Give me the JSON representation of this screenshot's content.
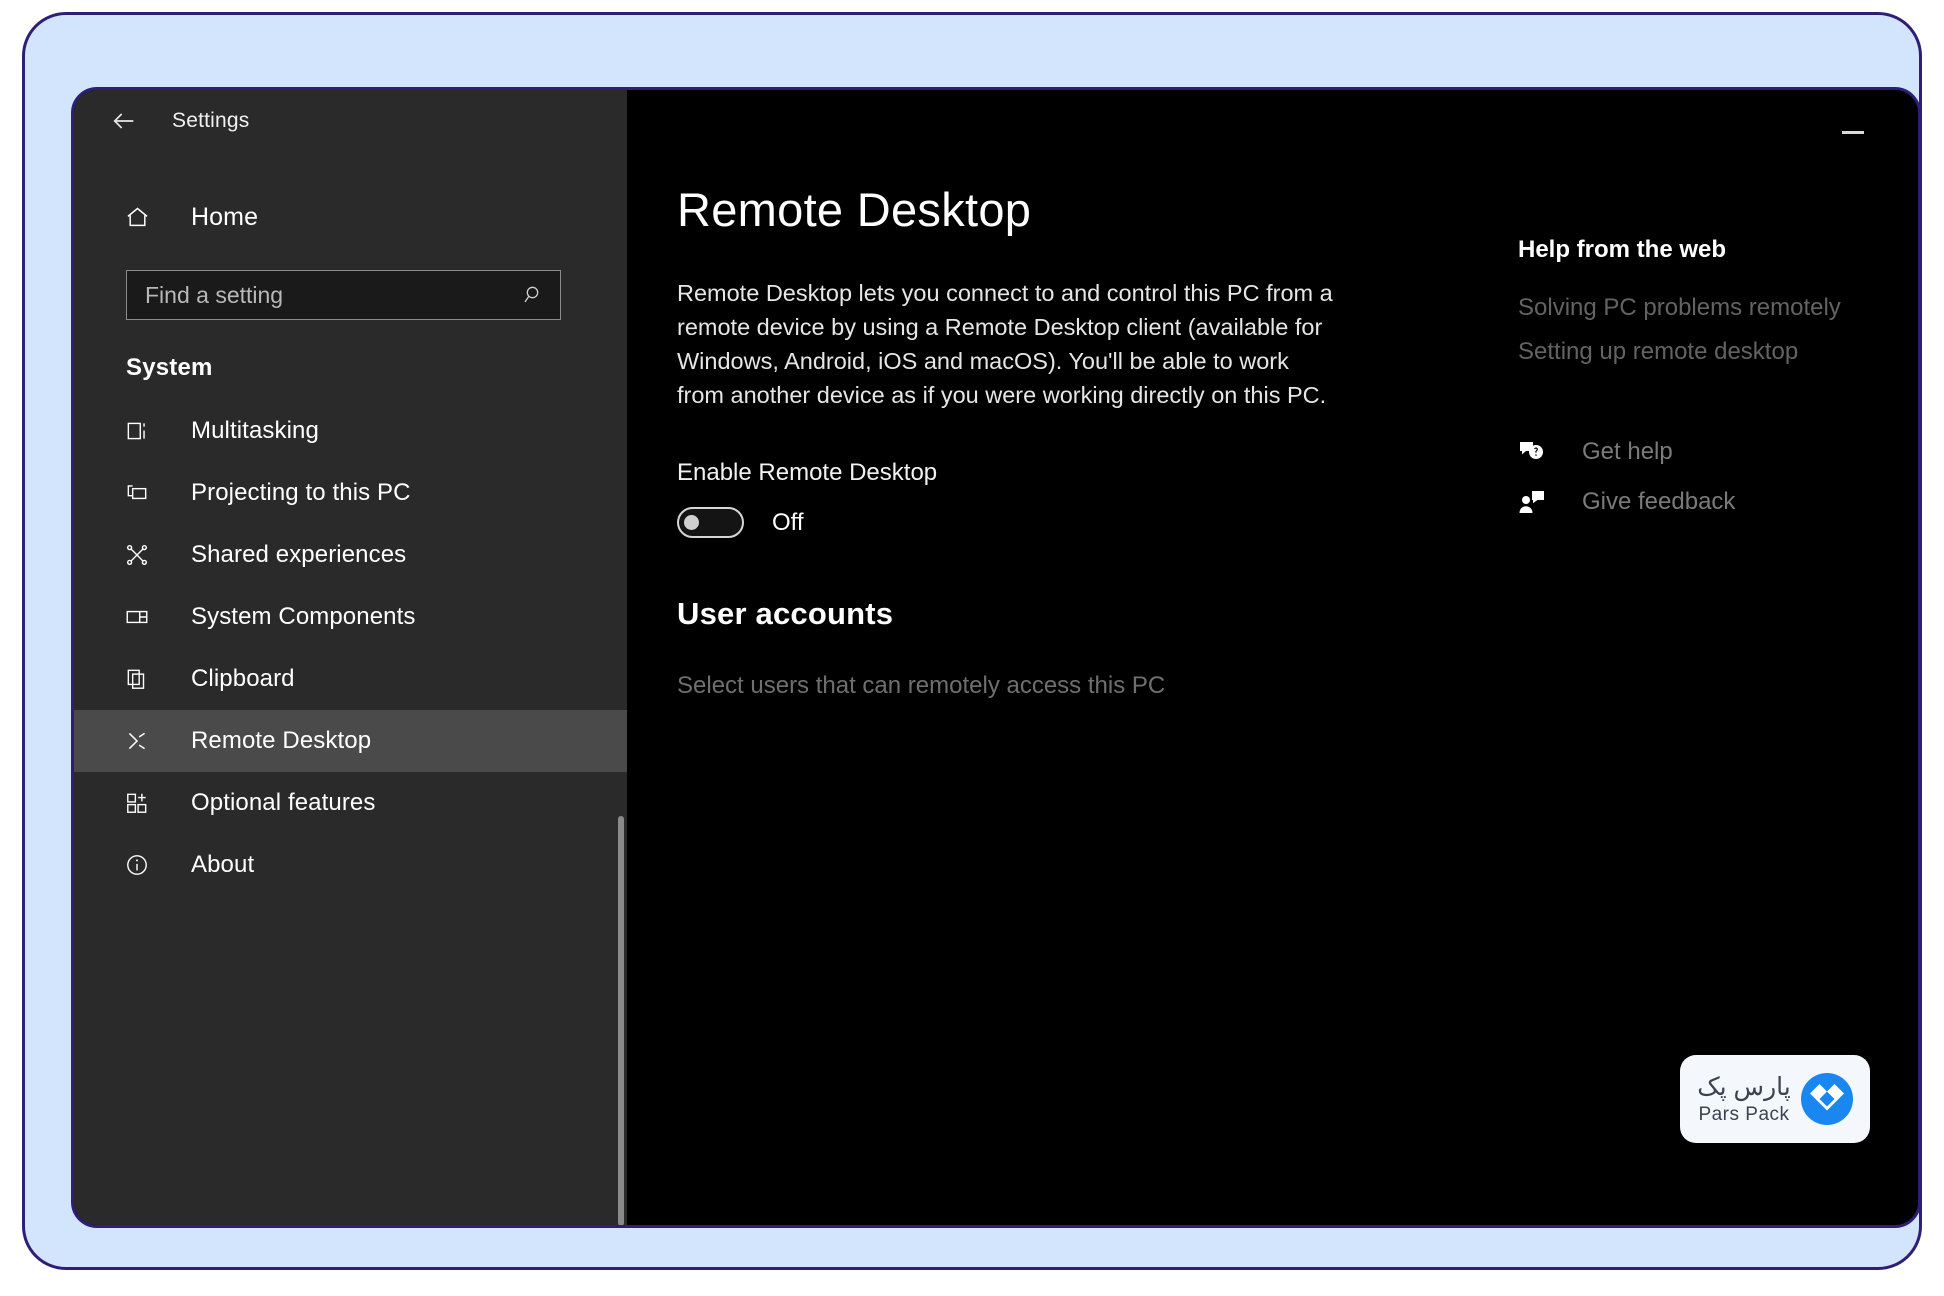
{
  "window": {
    "app_title": "Settings",
    "back_icon": "back-arrow-icon",
    "minimize_label": "–"
  },
  "sidebar": {
    "home": {
      "label": "Home",
      "icon": "home-icon"
    },
    "search": {
      "placeholder": "Find a setting",
      "value": "",
      "icon": "search-icon"
    },
    "group_heading": "System",
    "items": [
      {
        "label": "Multitasking",
        "icon": "multitasking-icon",
        "selected": false
      },
      {
        "label": "Projecting to this PC",
        "icon": "projecting-icon",
        "selected": false
      },
      {
        "label": "Shared experiences",
        "icon": "shared-experiences-icon",
        "selected": false
      },
      {
        "label": "System Components",
        "icon": "system-components-icon",
        "selected": false
      },
      {
        "label": "Clipboard",
        "icon": "clipboard-icon",
        "selected": false
      },
      {
        "label": "Remote Desktop",
        "icon": "remote-desktop-icon",
        "selected": true
      },
      {
        "label": "Optional features",
        "icon": "optional-features-icon",
        "selected": false
      },
      {
        "label": "About",
        "icon": "info-circle-icon",
        "selected": false
      }
    ]
  },
  "main": {
    "page_title": "Remote Desktop",
    "description": "Remote Desktop lets you connect to and control this PC from a remote device by using a Remote Desktop client (available for Windows, Android, iOS and macOS). You'll be able to work from another device as if you were working directly on this PC.",
    "enable_label": "Enable Remote Desktop",
    "toggle_state": "Off",
    "toggle_on": false,
    "user_accounts_heading": "User accounts",
    "user_accounts_link": "Select users that can remotely access this PC"
  },
  "help": {
    "title": "Help from the web",
    "links": [
      "Solving PC problems remotely",
      "Setting up remote desktop"
    ],
    "actions": [
      {
        "label": "Get help",
        "icon": "help-bubble-icon"
      },
      {
        "label": "Give feedback",
        "icon": "feedback-person-icon"
      }
    ]
  },
  "brand": {
    "name_fa": "پارس پک",
    "name_en": "Pars Pack",
    "icon": "parspack-logo-icon",
    "accent": "#1a87f0"
  },
  "colors": {
    "frame": "#d3e5fc",
    "frame_border": "#2d1f76",
    "sidebar_bg": "#2a2a2a",
    "content_bg": "#000000",
    "selected_bg": "#4a4a4a"
  }
}
